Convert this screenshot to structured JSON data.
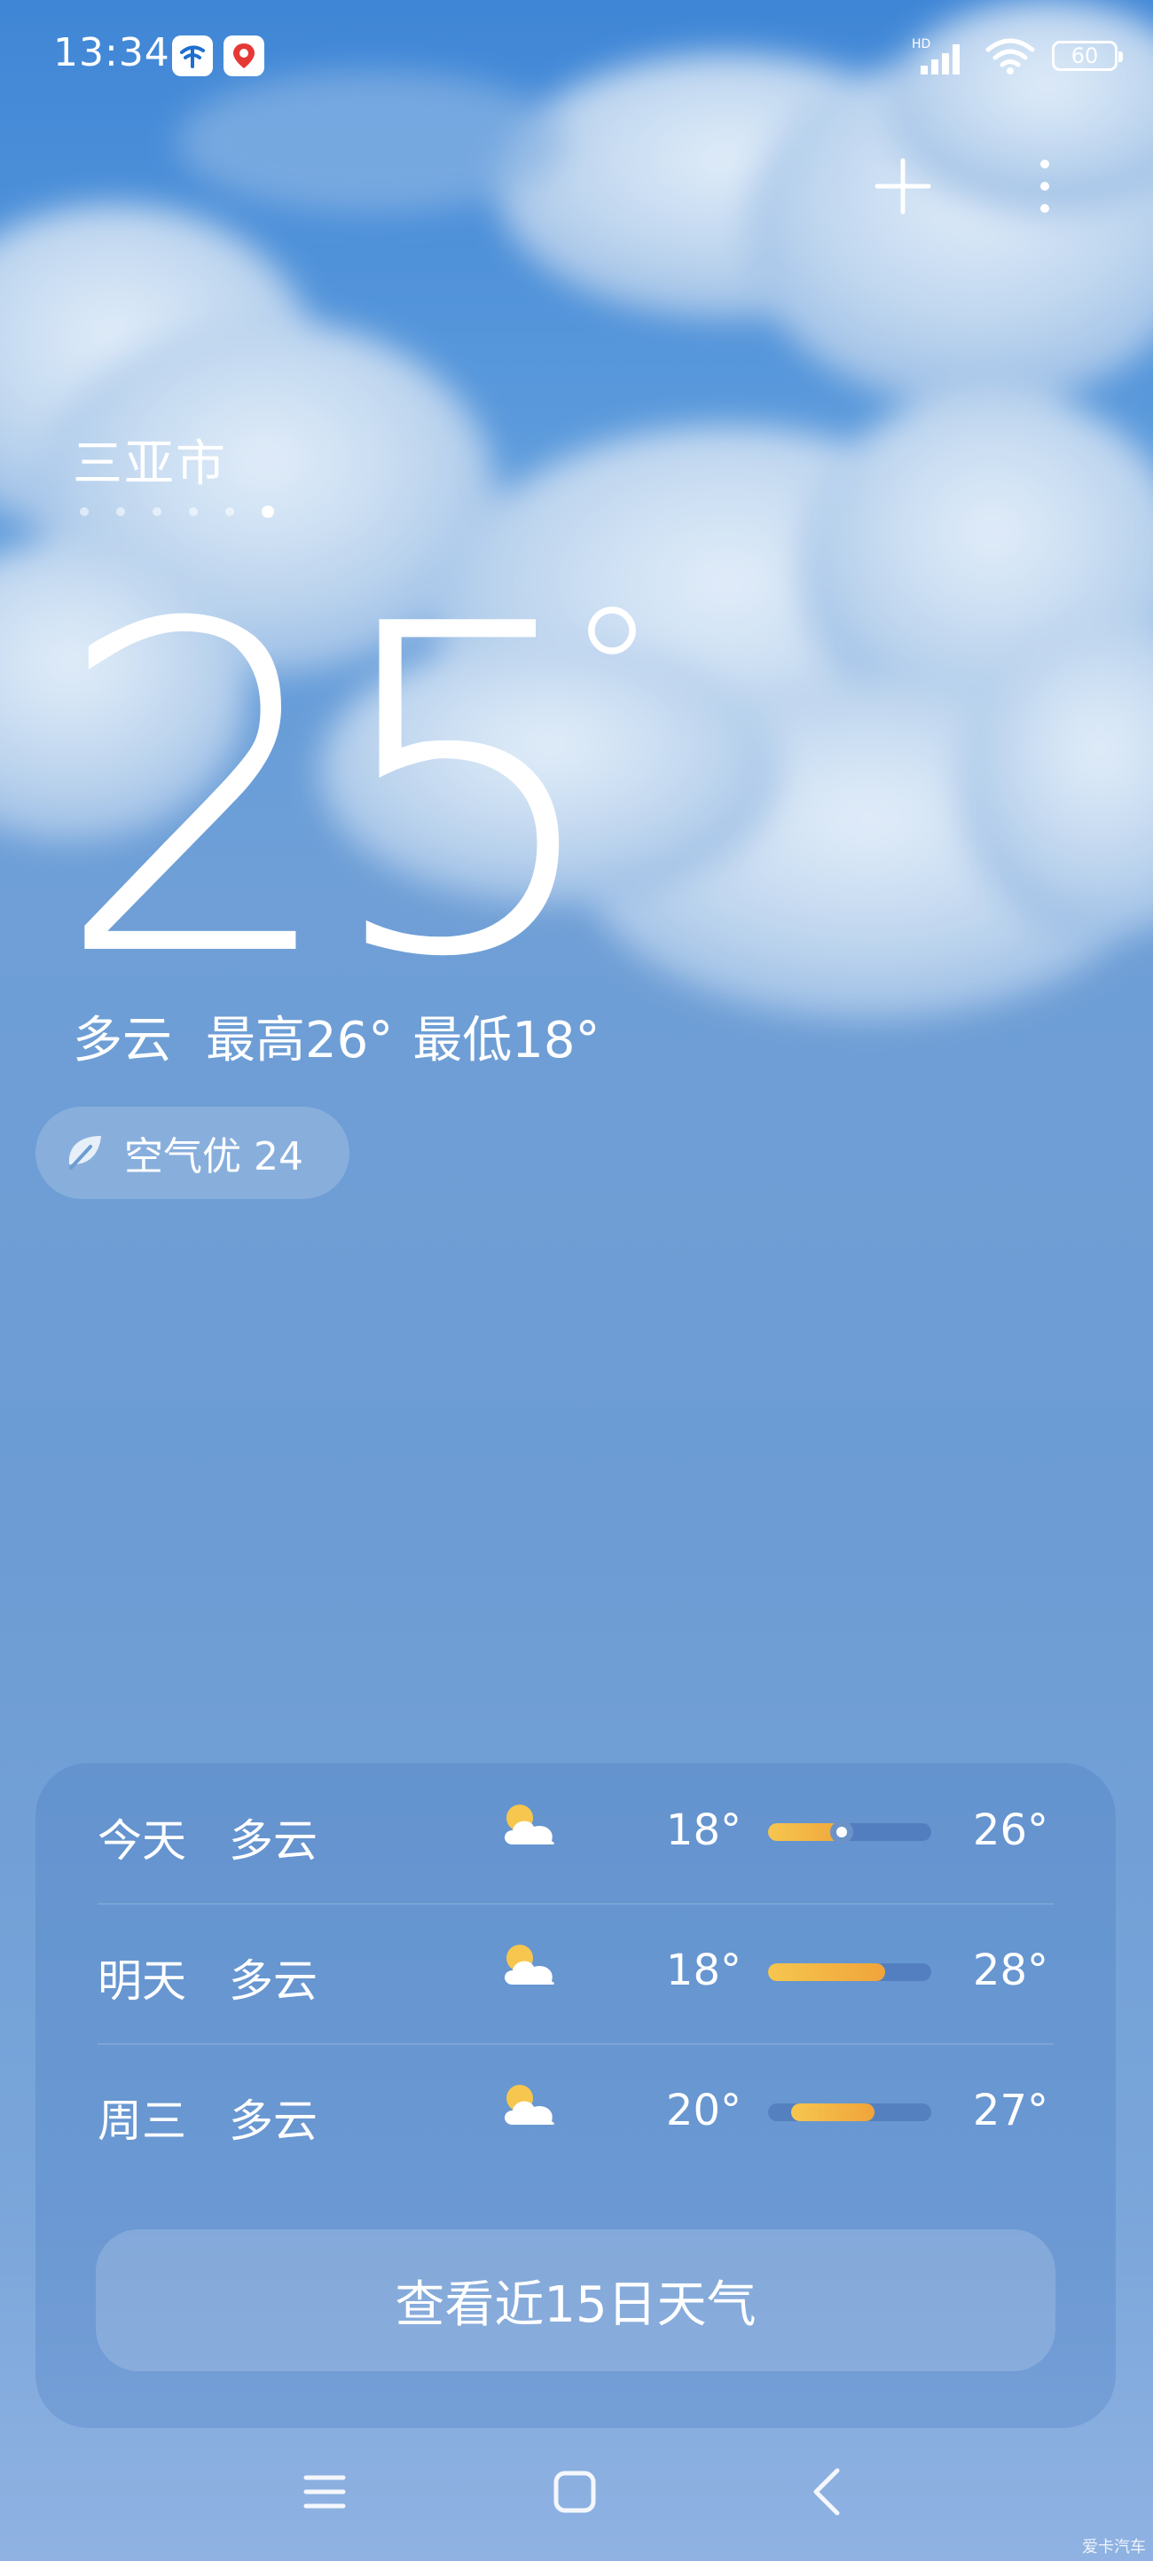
{
  "status_bar": {
    "time": "13:34",
    "network_label": "HD",
    "battery": "60",
    "icons": [
      "telecom-app-icon",
      "map-app-icon",
      "signal-icon",
      "wifi-icon",
      "battery-icon"
    ]
  },
  "top_actions": {
    "icons": [
      "add-icon",
      "more-vert-icon"
    ]
  },
  "location": {
    "city": "三亚市",
    "page_count": 6,
    "active_page_index": 5
  },
  "current": {
    "temperature": "25",
    "degree_symbol": "°",
    "condition": "多云",
    "high": "最高26°",
    "low": "最低18°"
  },
  "air_quality": {
    "icon": "leaf-icon",
    "label": "空气优 24"
  },
  "forecast": {
    "days": [
      {
        "day": "今天",
        "condition": "多云",
        "icon": "partly-cloudy-icon",
        "low": "18°",
        "high": "26°",
        "range_start": 0.0,
        "range_end": 0.5,
        "current_marker": 0.45
      },
      {
        "day": "明天",
        "condition": "多云",
        "icon": "partly-cloudy-icon",
        "low": "18°",
        "high": "28°",
        "range_start": 0.0,
        "range_end": 0.72
      },
      {
        "day": "周三",
        "condition": "多云",
        "icon": "partly-cloudy-icon",
        "low": "20°",
        "high": "27°",
        "range_start": 0.14,
        "range_end": 0.65
      }
    ],
    "more_button": "查看近15日天气"
  },
  "nav_bar": {
    "icons": [
      "menu-icon",
      "home-icon",
      "back-icon"
    ]
  },
  "watermark": "爱卡汽车",
  "colors": {
    "sky_top": "#3f86d6",
    "sky_bottom": "#8fb2e2",
    "bar_fill_start": "#f6c64f",
    "bar_fill_end": "#f0a43a"
  }
}
